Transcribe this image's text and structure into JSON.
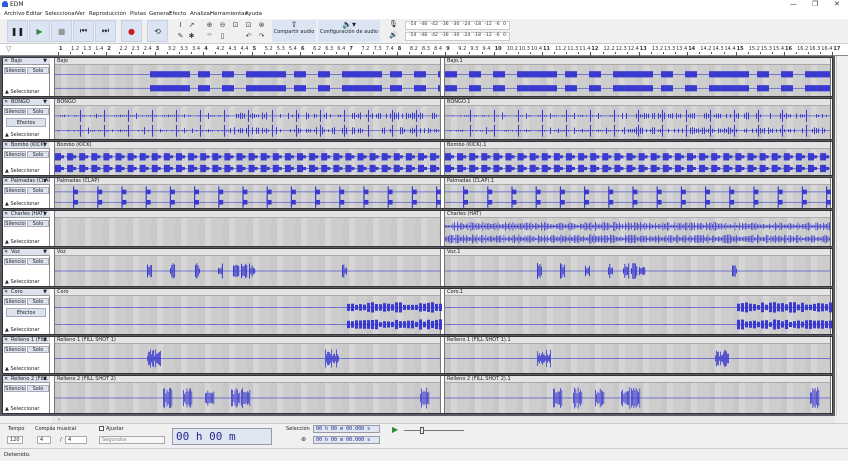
{
  "window": {
    "title": "EDM",
    "minimize": "—",
    "maximize": "❐",
    "close": "✕"
  },
  "menu": [
    "Archivo",
    "Editar",
    "Seleccionar",
    "Ver",
    "Reproducción",
    "Pistas",
    "Generar",
    "Efecto",
    "Analizar",
    "Herramientas",
    "Ayuda"
  ],
  "transport": [
    {
      "name": "pause-button",
      "icon": "❚❚"
    },
    {
      "name": "play-button",
      "icon": "▶"
    },
    {
      "name": "stop-button",
      "icon": "■"
    },
    {
      "name": "skip-start-button",
      "icon": "⏮"
    },
    {
      "name": "skip-end-button",
      "icon": "⏭"
    },
    {
      "name": "record-button",
      "icon": "●"
    },
    {
      "name": "loop-button",
      "icon": "⟲"
    }
  ],
  "toolbar": {
    "share_audio": "Compartir audio",
    "audio_setup": "Configuración de audio"
  },
  "meter": {
    "scale": [
      "-54",
      "-48",
      "-42",
      "-36",
      "-30",
      "-24",
      "-18",
      "-12",
      "-6",
      "0"
    ]
  },
  "ruler": [
    "1",
    "1.2",
    "1.3",
    "1.4",
    "2",
    "2.2",
    "2.3",
    "2.4",
    "3",
    "3.2",
    "3.3",
    "3.4",
    "4",
    "4.2",
    "4.3",
    "4.4",
    "5",
    "5.2",
    "5.3",
    "5.4",
    "6",
    "6.2",
    "6.3",
    "6.4",
    "7",
    "7.2",
    "7.3",
    "7.4",
    "8",
    "8.2",
    "8.3",
    "8.4",
    "9",
    "9.2",
    "9.3",
    "9.4",
    "10",
    "10.2",
    "10.3",
    "10.4",
    "11",
    "11.2",
    "11.3",
    "11.4",
    "12",
    "12.2",
    "12.3",
    "12.4",
    "13",
    "13.2",
    "13.3",
    "13.4",
    "14",
    "14.2",
    "14.3",
    "14.4",
    "15",
    "15.2",
    "15.3",
    "15.4",
    "16",
    "16.2",
    "16.3",
    "16.4",
    "17"
  ],
  "track_buttons": {
    "mute": "Silencio",
    "solo": "Solo",
    "effects": "Efectos",
    "select": "Seleccionar"
  },
  "tracks": [
    {
      "name": "Bajo",
      "clips": [
        "Bajo",
        "Bajo.1"
      ],
      "effects": false
    },
    {
      "name": "BONGO",
      "clips": [
        "BONGO",
        "BONGO.1"
      ],
      "effects": true
    },
    {
      "name": "Bombo (KICK)",
      "clips": [
        "Bombo (KICK)",
        "Bombo (KICK).1"
      ],
      "effects": false
    },
    {
      "name": "Palmadas (CLAP)",
      "clips": [
        "Palmadas (CLAP)",
        "Palmadas (CLAP).1"
      ],
      "effects": false
    },
    {
      "name": "Charles (HAT)",
      "clips": [
        "",
        "Charles (HAT)"
      ],
      "effects": false
    },
    {
      "name": "Voz",
      "clips": [
        "Voz",
        "Voz.1"
      ],
      "effects": false
    },
    {
      "name": "Coro",
      "clips": [
        "Coro",
        "Coro.1"
      ],
      "effects": true
    },
    {
      "name": "Relleno 1 (FILL SHOT 1)",
      "clips": [
        "Relleno 1 (FILL SHOT 1)",
        "Relleno 1 (FILL SHOT 1).1"
      ],
      "effects": false
    },
    {
      "name": "Relleno 2 (FILL SHOT 2)",
      "clips": [
        "Relleno 2 (FILL SHOT 2)",
        "Relleno 2 (FILL SHOT 2).1"
      ],
      "effects": false
    }
  ],
  "bottom": {
    "tempo_label": "Tempo",
    "tempo": "120",
    "timesig_label": "Compás musical",
    "timesig_num": "4",
    "timesig_sep": "/",
    "timesig_den": "4",
    "snap_label": "Ajustar",
    "snap_unit": "Segundos",
    "time": "00 h 00 m 00.000 s",
    "selection_label": "Selección",
    "sel_start": "00 h 00 m 00.000 s",
    "sel_end": "00 h 00 m 00.000 s"
  },
  "status": "Detenido.",
  "colors": {
    "wave": "#3a3ad0",
    "accent": "#2a5bd7",
    "record": "#c81e1e",
    "play": "#2e8b3a"
  }
}
